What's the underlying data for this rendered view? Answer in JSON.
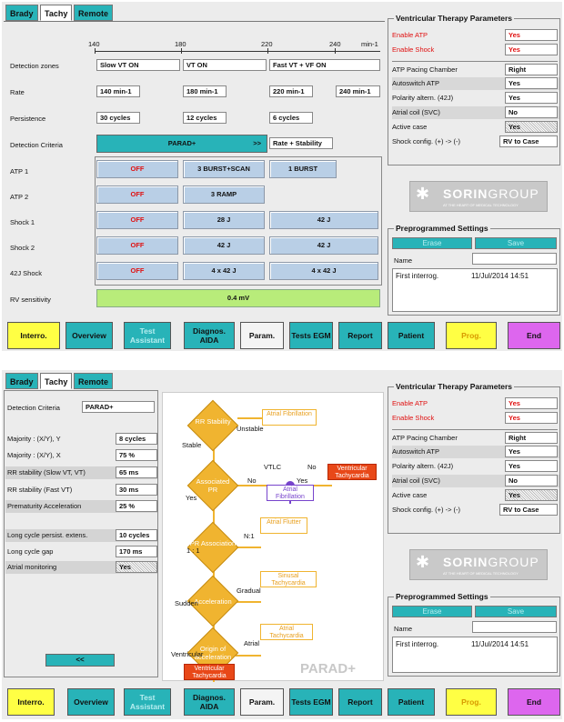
{
  "tabs": [
    "Brady",
    "Tachy",
    "Remote"
  ],
  "top": {
    "scale": [
      "140",
      "180",
      "220",
      "240",
      "min-1"
    ],
    "rows": {
      "detection_zones": {
        "label": "Detection zones",
        "values": [
          "Slow VT ON",
          "VT ON",
          "Fast VT + VF ON"
        ]
      },
      "rate": {
        "label": "Rate",
        "values": [
          "140 min-1",
          "180 min-1",
          "220 min-1",
          "240 min-1"
        ]
      },
      "persistence": {
        "label": "Persistence",
        "values": [
          "30 cycles",
          "12 cycles",
          "6 cycles"
        ]
      },
      "criteria": {
        "label": "Detection Criteria",
        "button": "PARAD+",
        "arrow": ">>",
        "value": "Rate + Stability"
      },
      "atp1": {
        "label": "ATP 1",
        "values": [
          "OFF",
          "3 BURST+SCAN",
          "1 BURST"
        ]
      },
      "atp2": {
        "label": "ATP 2",
        "values": [
          "OFF",
          "3 RAMP"
        ]
      },
      "shock1": {
        "label": "Shock 1",
        "values": [
          "OFF",
          "28 J",
          "42 J"
        ]
      },
      "shock2": {
        "label": "Shock 2",
        "values": [
          "OFF",
          "42 J",
          "42 J"
        ]
      },
      "shock42": {
        "label": "42J Shock",
        "values": [
          "OFF",
          "4 x 42 J",
          "4 x 42 J"
        ]
      },
      "rv": {
        "label": "RV sensitivity",
        "value": "0.4 mV"
      }
    }
  },
  "vtp": {
    "title": "Ventricular Therapy Parameters",
    "rows": [
      {
        "k": "Enable ATP",
        "v": "Yes"
      },
      {
        "k": "Enable Shock",
        "v": "Yes"
      },
      {
        "k": "ATP Pacing Chamber",
        "v": "Right"
      },
      {
        "k": "Autoswitch ATP",
        "v": "Yes"
      },
      {
        "k": "Polarity altern. (42J)",
        "v": "Yes"
      },
      {
        "k": "Atrial coil (SVC)",
        "v": "No"
      },
      {
        "k": "Active case",
        "v": "Yes"
      },
      {
        "k": "Shock config. (+) -> (-)",
        "v": "RV to Case"
      }
    ]
  },
  "logo": {
    "brand1": "SORIN",
    "brand2": "GROUP",
    "tagline": "AT THE HEART OF MEDICAL TECHNOLOGY"
  },
  "prep": {
    "title": "Preprogrammed Settings",
    "erase": "Erase",
    "save": "Save",
    "name_label": "Name",
    "entry_name": "First interrog.",
    "entry_date": "11/Jul/2014 14:51"
  },
  "bottom": [
    "Interro.",
    "Overview",
    "Test Assistant",
    "Diagnos. AIDA",
    "Param.",
    "Tests EGM",
    "Report",
    "Patient",
    "Prog.",
    "End"
  ],
  "bottom2": [
    "Interro.",
    "Overview",
    "Test Assistant",
    "Diagnos. AIDA",
    "Param.",
    "Tests EGM",
    "Report",
    "Patient",
    "Prog.",
    "End"
  ],
  "lower": {
    "criteria_label": "Detection Criteria",
    "criteria_value": "PARAD+",
    "params": [
      {
        "k": "Majority : (X/Y), Y",
        "v": "8 cycles"
      },
      {
        "k": "Majority : (X/Y), X",
        "v": "75 %"
      },
      {
        "k": "RR stability (Slow VT, VT)",
        "v": "65 ms"
      },
      {
        "k": "RR stability (Fast VT)",
        "v": "30 ms"
      },
      {
        "k": "Prematurity Acceleration",
        "v": "25 %"
      },
      {
        "k": "Long cycle persist. extens.",
        "v": "10 cycles"
      },
      {
        "k": "Long cycle gap",
        "v": "170 ms"
      },
      {
        "k": "Atrial monitoring",
        "v": "Yes"
      }
    ],
    "back": "<<"
  },
  "flow": {
    "d1": "RR Stability",
    "d2": "Associated PR",
    "d3": "PR Association",
    "d4": "Acceleration",
    "d5": "Origin of acceleration",
    "af": "Atrial Fibrillation",
    "vt": "Ventricular Tachycardia",
    "af2": "Atrial Fibrillation",
    "afl": "Atrial Flutter",
    "st": "Sinusal Tachycardia",
    "at": "Atrial Tachycardia",
    "vt2": "Ventricular Tachycardia",
    "unstable": "Unstable",
    "stable": "Stable",
    "vtlc": "VTLC",
    "no": "No",
    "no2": "No",
    "yes": "Yes",
    "yes2": "Yes",
    "n1": "N:1",
    "one": "1 : 1",
    "gradual": "Gradual",
    "sudden": "Sudden",
    "atrial": "Atrial",
    "ventricular": "Ventricular",
    "watermark": "PARAD+"
  }
}
